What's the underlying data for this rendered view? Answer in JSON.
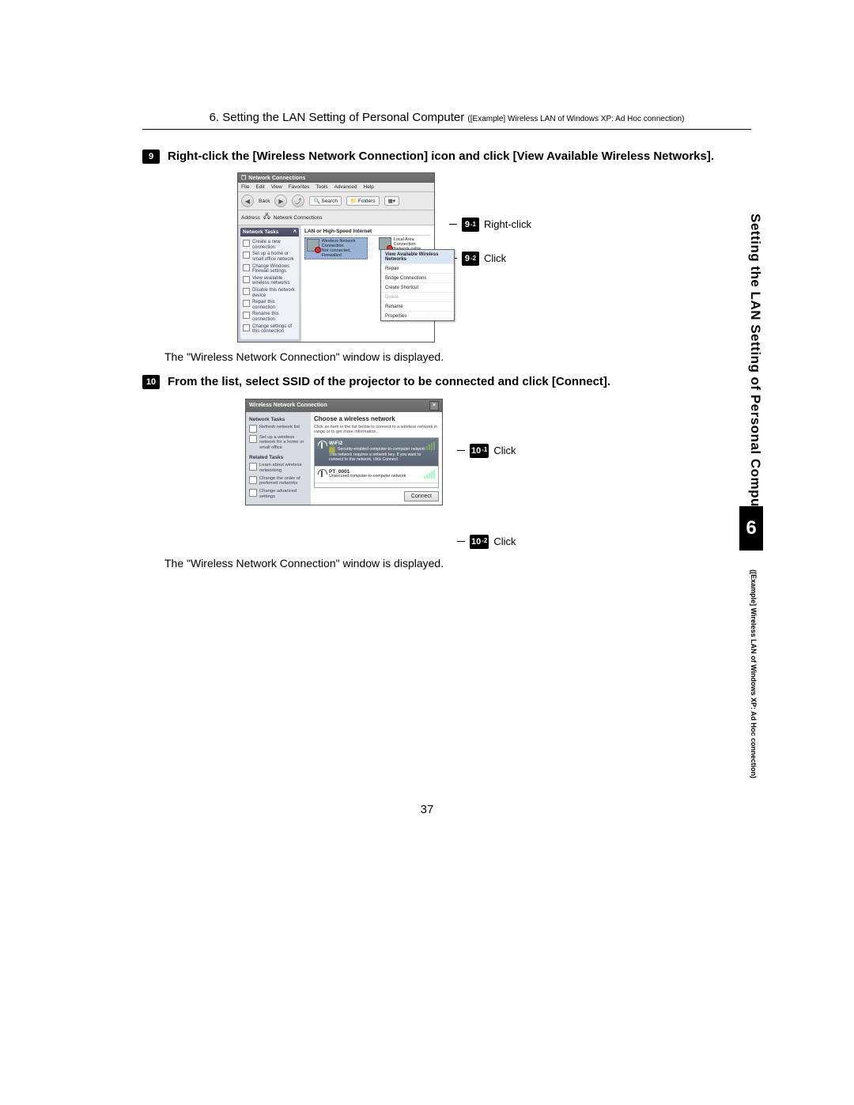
{
  "header": {
    "title": "6. Setting the LAN Setting of Personal Computer",
    "subtitle": "([Example] Wireless LAN of Windows XP: Ad Hoc connection)"
  },
  "sidebar": {
    "tab_main": "Setting the LAN Setting of Personal Computer",
    "chapter": "6",
    "tab_sub": "([Example] Wireless LAN of Windows XP: Ad Hoc connection)"
  },
  "steps": {
    "s9": {
      "num": "9",
      "text": "Right-click the [Wireless Network Connection] icon and click [View Available Wireless Networks].",
      "callouts": {
        "a": {
          "badge": "9",
          "sub": "-1",
          "label": "Right-click"
        },
        "b": {
          "badge": "9",
          "sub": "-2",
          "label": "Click"
        }
      },
      "note": "The \"Wireless Network Connection\" window is displayed."
    },
    "s10": {
      "num": "10",
      "text": "From the list, select SSID of the projector to be connected and click [Connect].",
      "callouts": {
        "a": {
          "badge": "10",
          "sub": "-1",
          "label": "Click"
        },
        "b": {
          "badge": "10",
          "sub": "-2",
          "label": "Click"
        }
      },
      "note": "The \"Wireless Network Connection\" window is displayed."
    }
  },
  "screenshot1": {
    "title": "Network Connections",
    "menubar": [
      "File",
      "Edit",
      "View",
      "Favorites",
      "Tools",
      "Advanced",
      "Help"
    ],
    "toolbar": {
      "back": "Back",
      "search": "Search",
      "folders": "Folders"
    },
    "addressbar": {
      "label": "Address",
      "value": "Network Connections"
    },
    "tasks_panel_title": "Network Tasks",
    "tasks": [
      "Create a new connection",
      "Set up a home or small office network",
      "Change Windows Firewall settings",
      "View available wireless networks",
      "Disable this network device",
      "Repair this connection",
      "Rename this connection",
      "Change settings of this connection"
    ],
    "group_label": "LAN or High-Speed Internet",
    "connections": [
      {
        "name": "Wireless Network Connection",
        "status": "Not connected, Firewalled"
      },
      {
        "name": "Local Area Connection",
        "status": "Network cable unplugged"
      }
    ],
    "context_menu": [
      {
        "label": "View Available Wireless Networks",
        "hl": true
      },
      {
        "label": "Repair"
      },
      {
        "label": "Bridge Connections"
      },
      {
        "label": "Create Shortcut"
      },
      {
        "label": "Delete",
        "dim": true
      },
      {
        "label": "Rename"
      },
      {
        "label": "Properties"
      }
    ]
  },
  "screenshot2": {
    "title": "Wireless Network Connection",
    "heading": "Choose a wireless network",
    "desc": "Click an item in the list below to connect to a wireless network in range or to get more information.",
    "side_sections": {
      "s1_title": "Network Tasks",
      "s1_items": [
        "Refresh network list",
        "Set up a wireless network for a home or small office"
      ],
      "s2_title": "Related Tasks",
      "s2_items": [
        "Learn about wireless networking",
        "Change the order of preferred networks",
        "Change advanced settings"
      ]
    },
    "networks": [
      {
        "ssid": "WiFi2",
        "security": "Security-enabled computer-to-computer network",
        "note": "This network requires a network key. If you want to connect to this network, click Connect.",
        "selected": true
      },
      {
        "ssid": "PT_0001",
        "security": "Unsecured computer-to-computer network",
        "selected": false
      }
    ],
    "connect_button": "Connect"
  },
  "page_number": "37"
}
